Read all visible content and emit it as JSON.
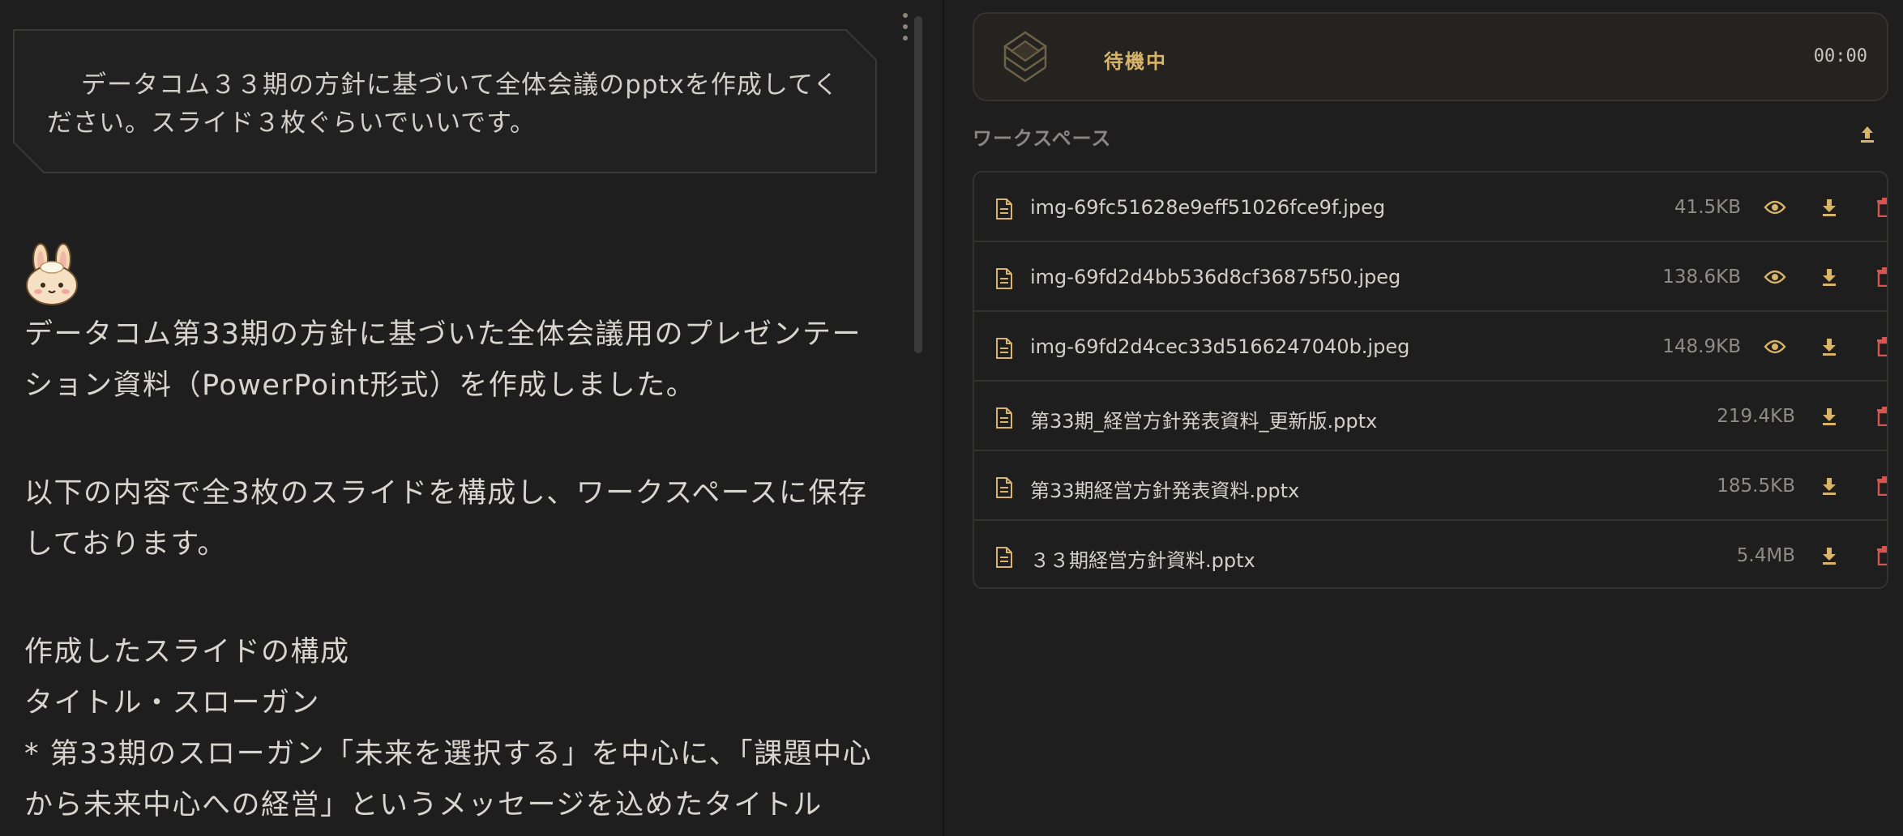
{
  "chat": {
    "user_message": "データコム３３期の方針に基づいて全体会議のpptxを作成してください。スライド３枚ぐらいでいいです。",
    "assistant": {
      "p1": "データコム第33期の方針に基づいた全体会議用のプレゼンテーション資料（PowerPoint形式）を作成しました。",
      "p2": "以下の内容で全3枚のスライドを構成し、ワークスペースに保存しております。",
      "p3": "作成したスライドの構成",
      "p4": "タイトル・スローガン",
      "p5": "* 第33期のスローガン「未来を選択する」を中心に、「課題中心から未来中心への経営」というメッセージを込めたタイトル"
    }
  },
  "status": {
    "label": "待機中",
    "time": "00:00",
    "icon": "layers-icon"
  },
  "workspace": {
    "title": "ワークスペース",
    "files": [
      {
        "name": "img-69fc51628e9eff51026fce9f.jpeg",
        "size": "41.5KB",
        "previewable": true
      },
      {
        "name": "img-69fd2d4bb536d8cf36875f50.jpeg",
        "size": "138.6KB",
        "previewable": true
      },
      {
        "name": "img-69fd2d4cec33d5166247040b.jpeg",
        "size": "148.9KB",
        "previewable": true
      },
      {
        "name": "第33期_経営方針発表資料_更新版.pptx",
        "size": "219.4KB",
        "previewable": false
      },
      {
        "name": "第33期経営方針発表資料.pptx",
        "size": "185.5KB",
        "previewable": false
      },
      {
        "name": "３３期経営方針資料.pptx",
        "size": "5.4MB",
        "previewable": false
      }
    ]
  },
  "colors": {
    "accent": "#d8b46a",
    "danger": "#d9534f",
    "background": "#1e1e1e"
  }
}
